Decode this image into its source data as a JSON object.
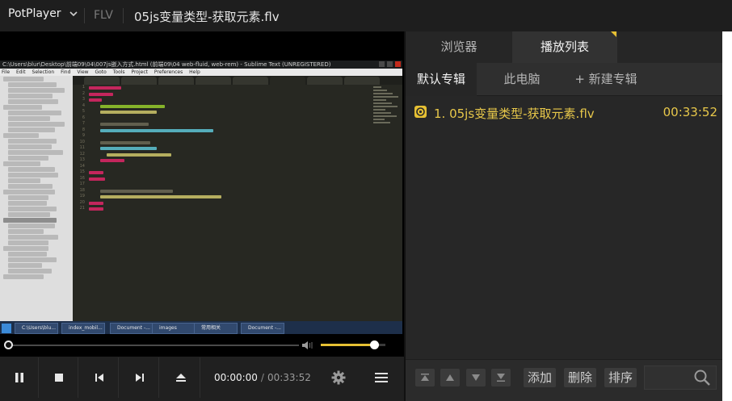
{
  "app": {
    "brand": "PotPlayer",
    "format": "FLV",
    "file_title": "05js变量类型-获取元素.flv"
  },
  "video": {
    "window_title": "C:\\Users\\blur\\Desktop\\前端09\\04\\007js嵌入方式.html (前端09\\04 web-fluid, web-rem) - Sublime Text (UNREGISTERED)",
    "menu": [
      "File",
      "Edit",
      "Selection",
      "Find",
      "View",
      "Goto",
      "Tools",
      "Project",
      "Preferences",
      "Help"
    ],
    "taskbar": [
      "C:\\Users\\blu...",
      "index_mobil...",
      "Document -...",
      "images",
      "常用相关",
      "Document -..."
    ]
  },
  "playback": {
    "progress": 0,
    "volume": 0.83,
    "current_time": "00:00:00",
    "separator": "/",
    "total_time": "00:33:52"
  },
  "panel": {
    "tabs": [
      "浏览器",
      "播放列表"
    ],
    "albums": [
      "默认专辑",
      "此电脑",
      "+ 新建专辑"
    ],
    "items": [
      {
        "title": "1. 05js变量类型-获取元素.flv",
        "duration": "00:33:52"
      }
    ],
    "buttons": {
      "add": "添加",
      "delete": "删除",
      "sort": "排序"
    },
    "search_placeholder": ""
  },
  "colors": {
    "accent": "#e6c033",
    "background": "#000000",
    "panel": "#2a2a2a"
  }
}
